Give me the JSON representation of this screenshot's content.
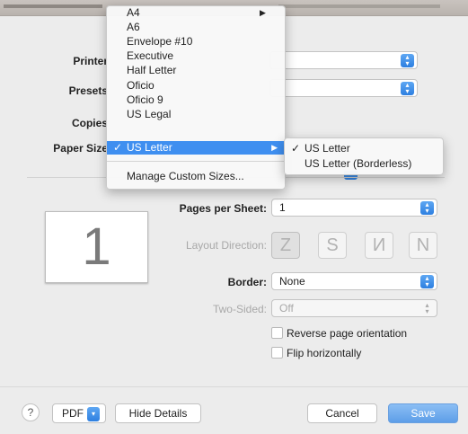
{
  "window": {},
  "labels": {
    "printer": "Printer",
    "presets": "Presets",
    "copies": "Copies",
    "paper_size": "Paper Size"
  },
  "paper_menu": {
    "items": [
      "A4",
      "A6",
      "Envelope #10",
      "Executive",
      "Half Letter",
      "Oficio",
      "Oficio 9",
      "US Legal"
    ],
    "selected": "US Letter",
    "checkmark": "✓",
    "submenu_arrow": "▶",
    "manage": "Manage Custom Sizes..."
  },
  "paper_submenu": {
    "selected": "US Letter",
    "other": "US Letter (Borderless)",
    "checkmark": "✓"
  },
  "preview": {
    "page_number": "1"
  },
  "layout": {
    "pages_per_sheet_label": "Pages per Sheet:",
    "pages_per_sheet_value": "1",
    "layout_direction_label": "Layout Direction:",
    "direction_glyphs": [
      "Z",
      "S",
      "N",
      "N"
    ],
    "border_label": "Border:",
    "border_value": "None",
    "two_sided_label": "Two-Sided:",
    "two_sided_value": "Off",
    "reverse_label": "Reverse page orientation",
    "flip_label": "Flip horizontally"
  },
  "footer": {
    "help": "?",
    "pdf": "PDF",
    "pdf_arrow": "▾",
    "hide_details": "Hide Details",
    "cancel": "Cancel",
    "save": "Save"
  },
  "colors": {
    "accent": "#3f8ff0",
    "background": "#ececec"
  }
}
